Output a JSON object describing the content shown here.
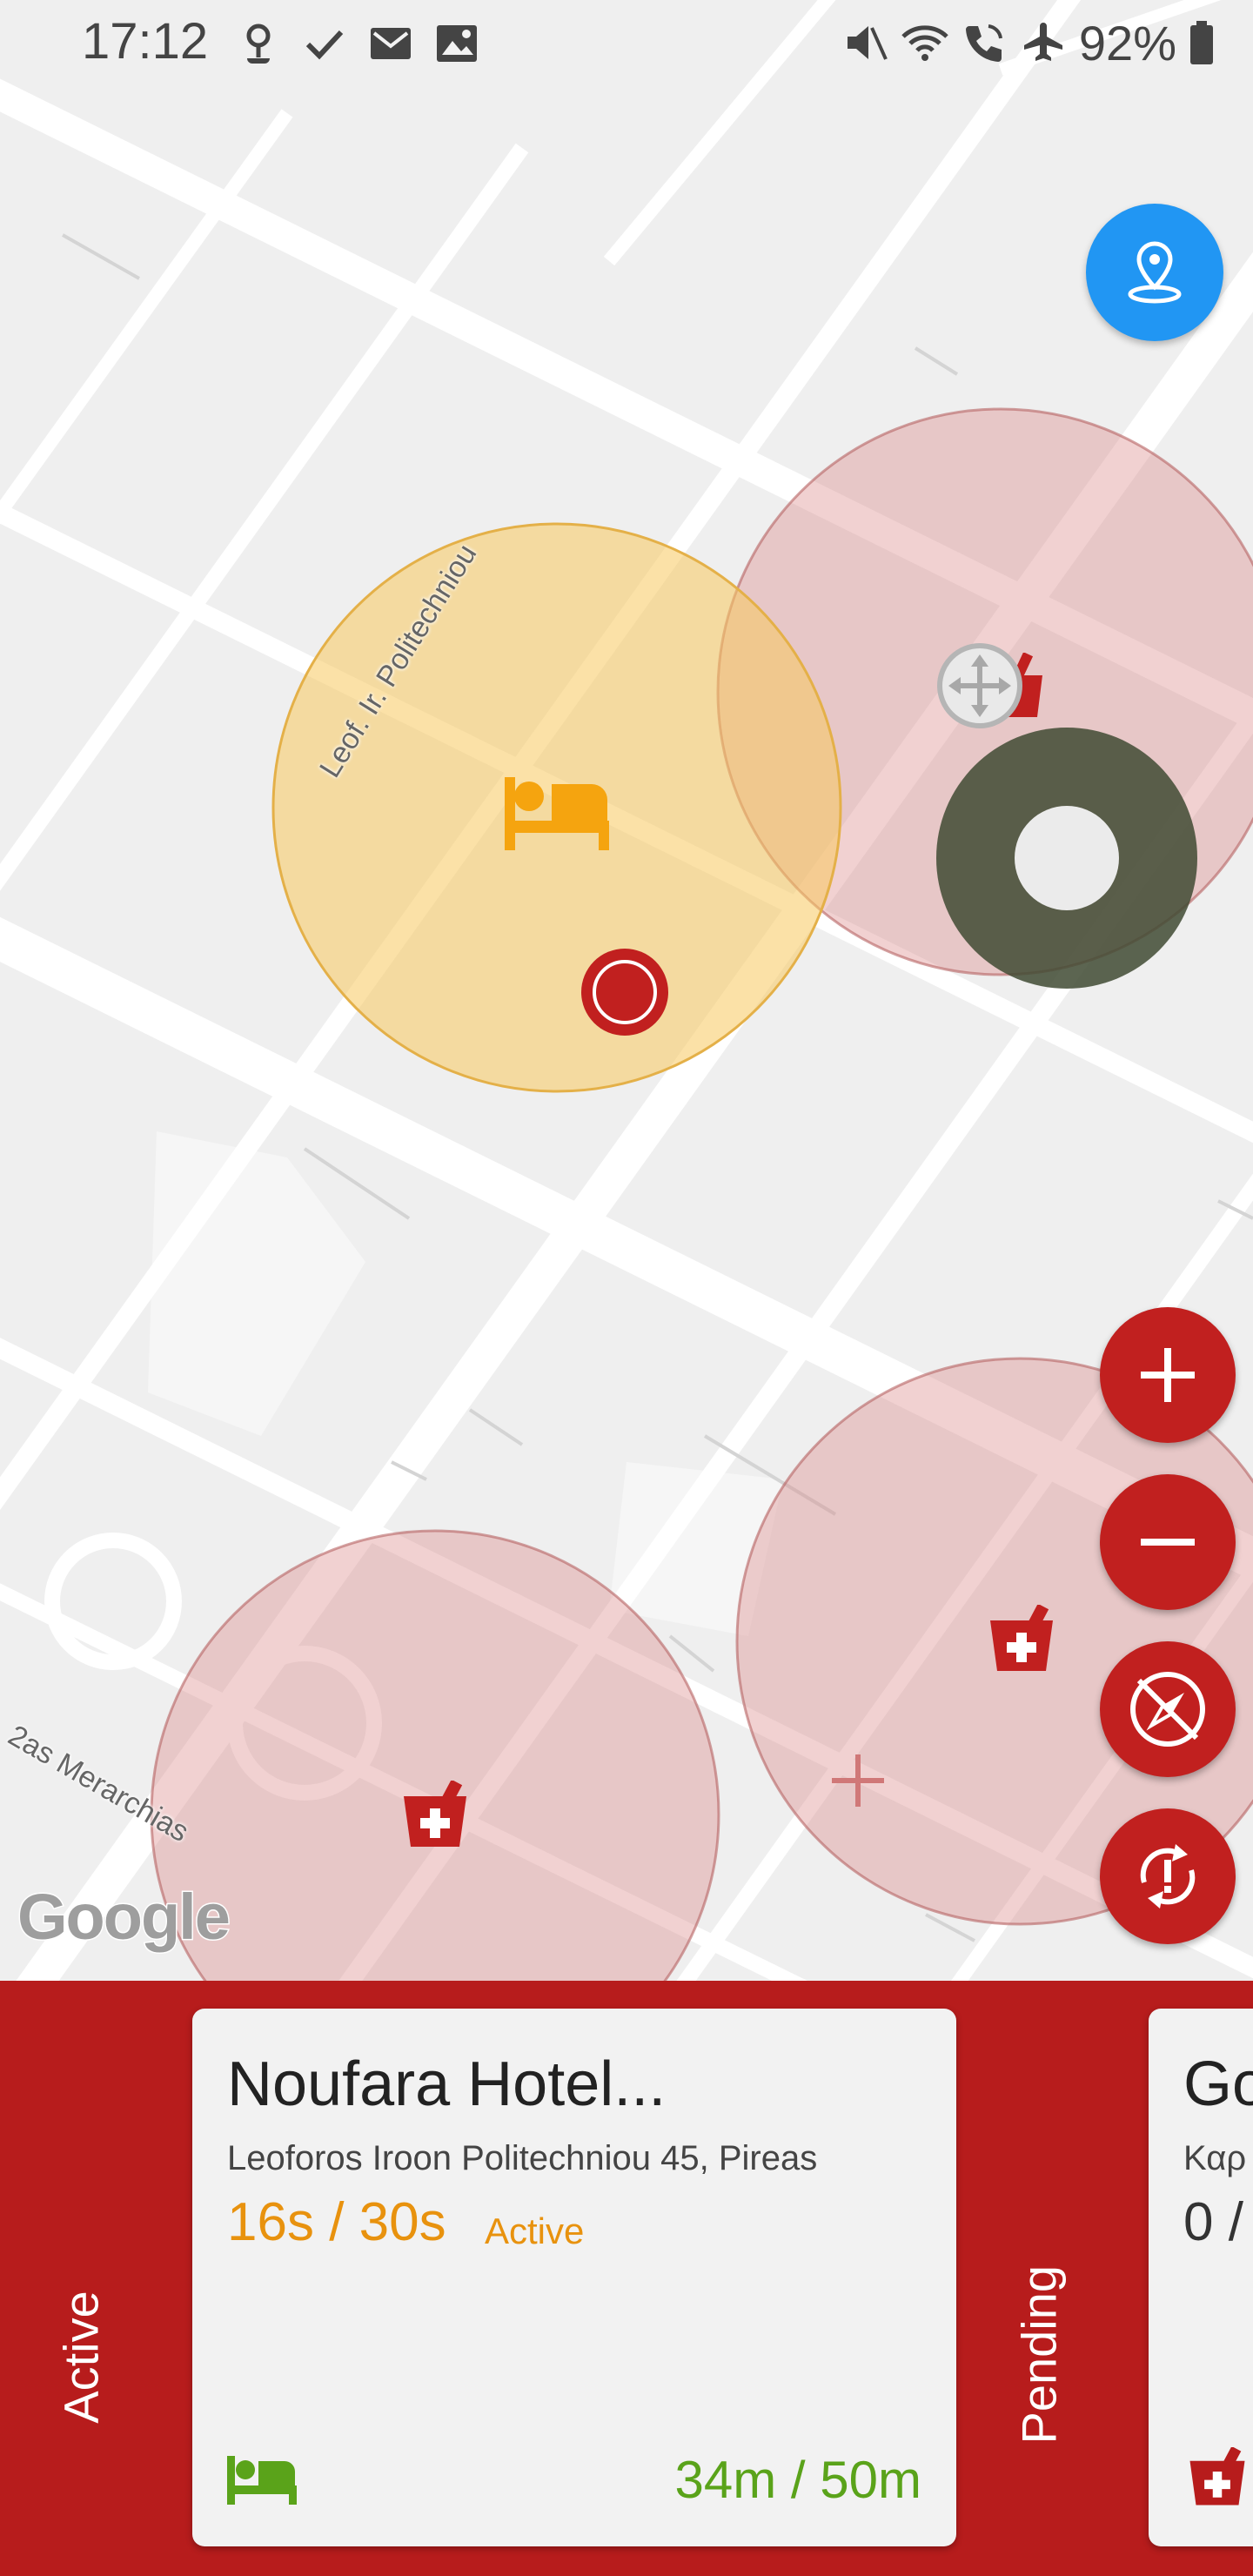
{
  "status_bar": {
    "time": "17:12",
    "battery": "92%",
    "left_icons": [
      "location-pin-icon",
      "check-icon",
      "mail-icon",
      "image-icon"
    ],
    "right_icons": [
      "mute-icon",
      "wifi-icon",
      "wifi-call-icon",
      "airplane-icon",
      "battery-icon"
    ]
  },
  "map": {
    "street_labels": [
      "Leof. Ir. Politechniou",
      "2as Merarchias"
    ],
    "attribution": "Google",
    "zones": [
      {
        "type": "hotel",
        "color": "#f7c95f",
        "state": "active"
      },
      {
        "type": "pharmacy",
        "color": "#d98686"
      },
      {
        "type": "pharmacy",
        "color": "#d98686"
      },
      {
        "type": "pharmacy",
        "color": "#d98686"
      }
    ],
    "icons": {
      "hotel": "bed-icon",
      "pharmacy": "mortar-pestle-cross-icon",
      "user": "user-position-icon",
      "joystick": "joystick-icon"
    }
  },
  "controls": {
    "location_button": "location-icon",
    "zoom_in": "plus-icon",
    "zoom_out": "minus-icon",
    "compass": "compass-off-icon",
    "sync": "sync-alert-icon"
  },
  "colors": {
    "primary_red": "#b71c1c",
    "fab_red": "#c1201f",
    "active_orange": "#e8920e",
    "distance_green": "#5aa31a",
    "location_blue": "#2196f3"
  },
  "panel": {
    "active_label": "Active",
    "pending_label": "Pending",
    "active_card": {
      "title": "Noufara Hotel...",
      "address": "Leoforos Iroon Politechniou 45, Pireas",
      "timer": "16s / 30s",
      "status": "Active",
      "distance": "34m / 50m",
      "type_icon": "bed-icon"
    },
    "pending_card": {
      "title": "Go",
      "address": "Καρ",
      "timer": "0 /",
      "type_icon": "pharmacy-icon"
    }
  }
}
